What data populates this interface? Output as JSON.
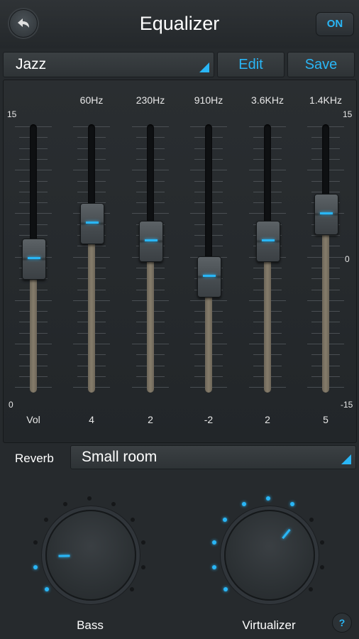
{
  "header": {
    "title": "Equalizer",
    "power_label": "ON"
  },
  "preset": {
    "label": "Jazz"
  },
  "toolbar": {
    "edit_label": "Edit",
    "save_label": "Save"
  },
  "eq": {
    "scale_left_top": "15",
    "scale_left_bottom": "0",
    "scale_right_top": "15",
    "scale_right_mid": "0",
    "scale_right_bottom": "-15",
    "bands": [
      {
        "freq": "",
        "value_label": "Vol",
        "level": 0.5
      },
      {
        "freq": "60Hz",
        "value_label": "4",
        "level": 0.633
      },
      {
        "freq": "230Hz",
        "value_label": "2",
        "level": 0.567
      },
      {
        "freq": "910Hz",
        "value_label": "-2",
        "level": 0.433
      },
      {
        "freq": "3.6KHz",
        "value_label": "2",
        "level": 0.567
      },
      {
        "freq": "1.4KHz",
        "value_label": "5",
        "level": 0.667
      }
    ]
  },
  "reverb": {
    "label": "Reverb",
    "value": "Small room"
  },
  "bass": {
    "label": "Bass",
    "level": 0.15
  },
  "virtualizer": {
    "label": "Virtualizer",
    "level": 0.65
  },
  "colors": {
    "accent": "#29b6f6",
    "background": "#262a2d"
  },
  "icons": {
    "back": "back-arrow-icon",
    "dropdown": "dropdown-corner-icon",
    "help": "help-icon"
  },
  "help": {
    "label": "?"
  }
}
